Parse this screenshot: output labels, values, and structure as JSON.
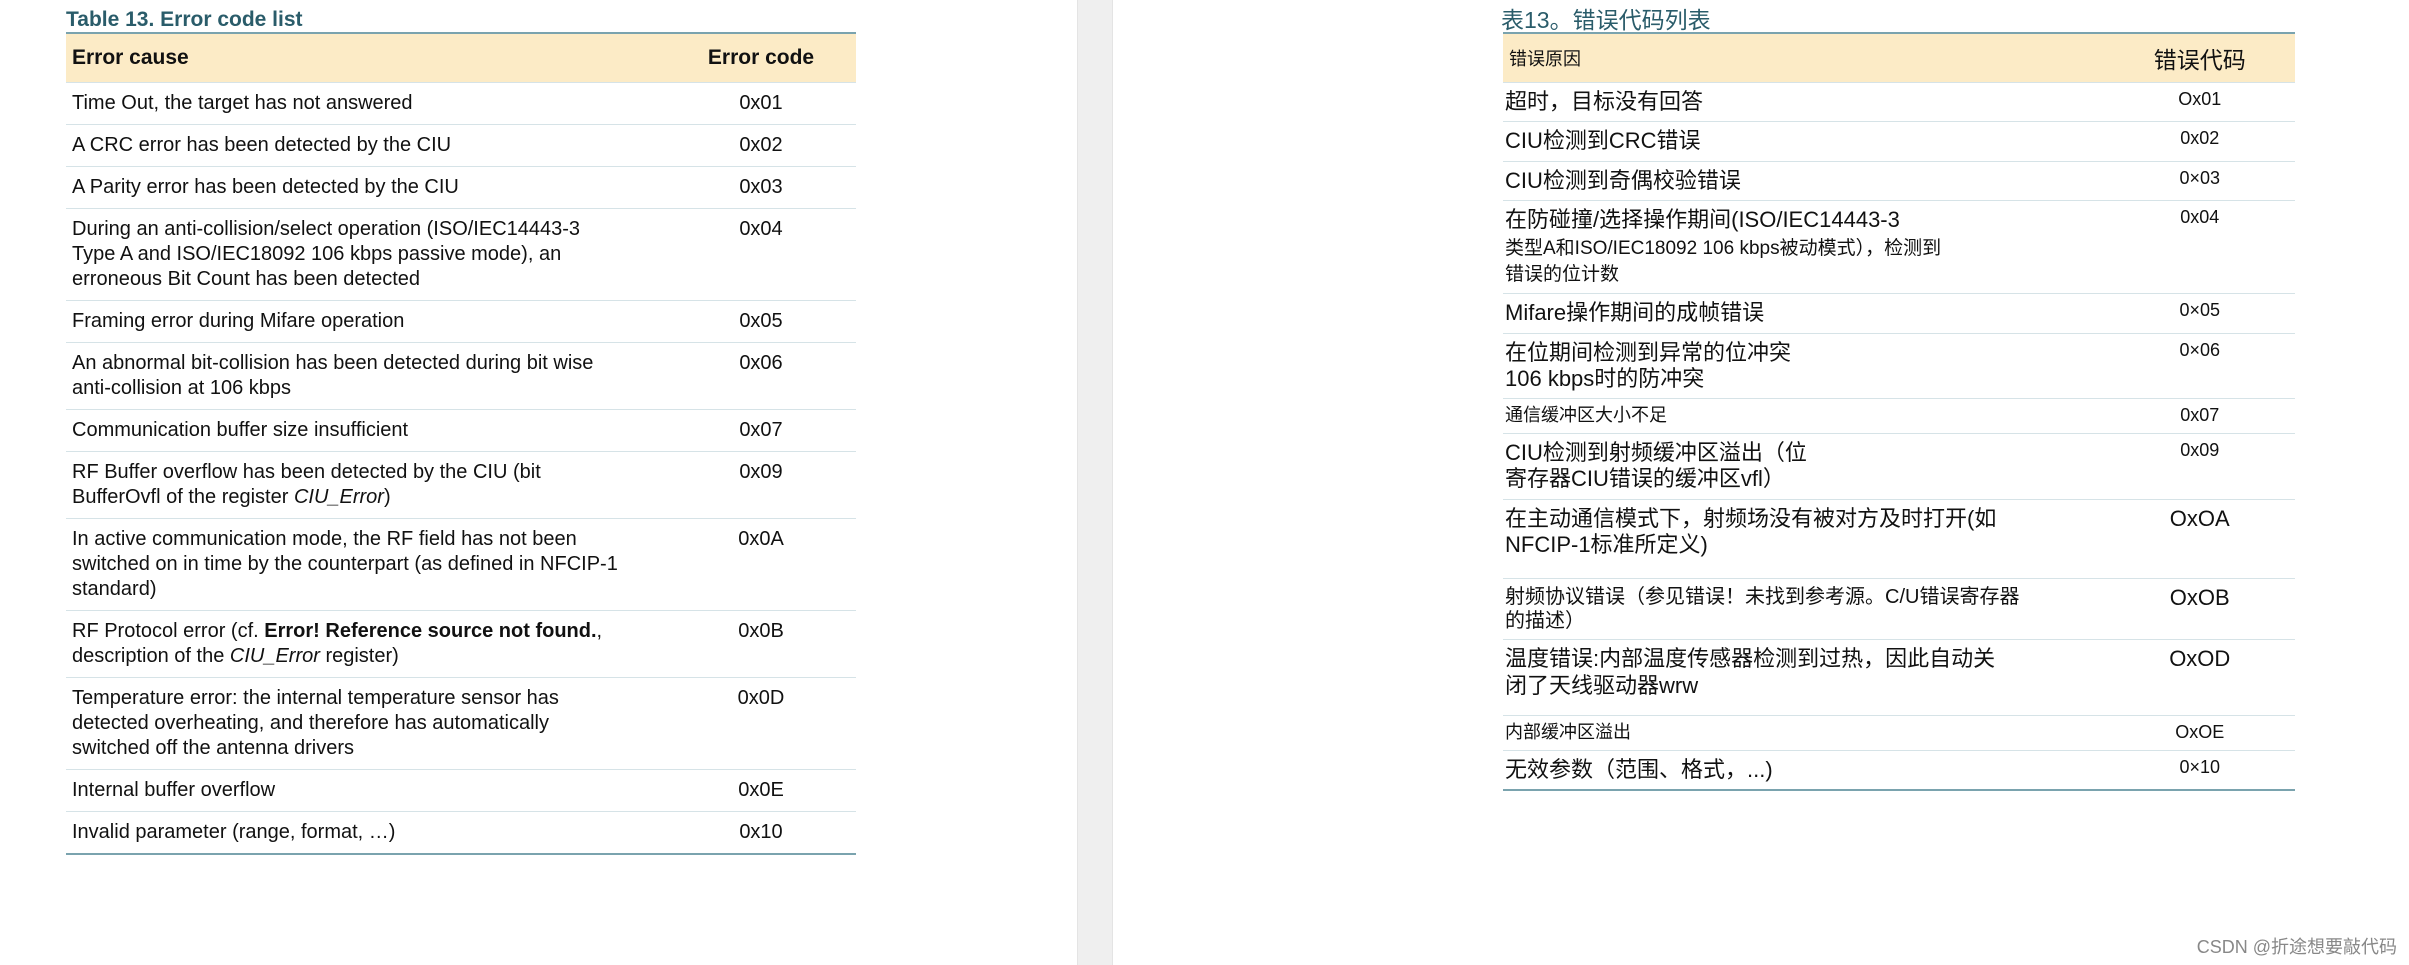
{
  "left": {
    "title": "Table 13.    Error code list",
    "header": {
      "cause": "Error cause",
      "code": "Error code"
    },
    "rows": [
      {
        "cause": "Time Out, the target has not answered",
        "code": "0x01"
      },
      {
        "cause": "A CRC error has been detected by the CIU",
        "code": "0x02"
      },
      {
        "cause": "A Parity error has been detected by the CIU",
        "code": "0x03"
      },
      {
        "cause_lines": [
          "During an anti-collision/select operation (ISO/IEC14443-3",
          "Type A and ISO/IEC18092 106 kbps passive mode), an",
          "erroneous Bit Count has been detected"
        ],
        "code": "0x04"
      },
      {
        "cause": "Framing error during Mifare operation",
        "code": "0x05"
      },
      {
        "cause_lines": [
          "An abnormal bit-collision has been detected during bit wise",
          "anti-collision at 106 kbps"
        ],
        "code": "0x06"
      },
      {
        "cause": "Communication buffer size insufficient",
        "code": "0x07"
      },
      {
        "cause_a": "RF Buffer overflow has been detected by the CIU (bit",
        "cause_b": "BufferOvfl of the register ",
        "cause_italic": "CIU_Error",
        "cause_c": ")",
        "code": "0x09"
      },
      {
        "cause_lines": [
          "In active communication mode, the RF field has not been",
          "switched on in time by the counterpart (as defined in NFCIP-1",
          "standard)"
        ],
        "code": "0x0A"
      },
      {
        "cause_a": "RF Protocol error (cf. ",
        "cause_bold": "Error! Reference source not found.",
        "cause_b": ",",
        "cause_c": "description of the ",
        "cause_italic": "CIU_Error",
        "cause_d": " register)",
        "code": "0x0B"
      },
      {
        "cause_lines": [
          "Temperature error: the internal temperature sensor has",
          "detected overheating, and therefore has automatically",
          "switched off the antenna drivers"
        ],
        "code": "0x0D"
      },
      {
        "cause": "Internal buffer overflow",
        "code": "0x0E"
      },
      {
        "cause": "Invalid parameter (range, format, …)",
        "code": "0x10"
      }
    ]
  },
  "right": {
    "title": "表13。错误代码列表",
    "header": {
      "cause": "错误原因",
      "code": "错误代码"
    },
    "rows": [
      {
        "cause": "超时，目标没有回答",
        "code": "Ox01"
      },
      {
        "cause": "CIU检测到CRC错误",
        "code": "0x02"
      },
      {
        "cause": "CIU检测到奇偶校验错误",
        "code": "0×03"
      },
      {
        "cause_lines": [
          "在防碰撞/选择操作期间(ISO/IEC14443-3",
          "类型A和ISO/IEC18092 106 kbps被动模式），检测到",
          "错误的位计数"
        ],
        "code": "0x04"
      },
      {
        "cause": "Mifare操作期间的成帧错误",
        "code": "0×05"
      },
      {
        "cause_lines": [
          "在位期间检测到异常的位冲突",
          "106 kbps时的防冲突"
        ],
        "code": "0×06"
      },
      {
        "cause": "通信缓冲区大小不足",
        "code": "0x07"
      },
      {
        "cause_lines": [
          "CIU检测到射频缓冲区溢出（位",
          "寄存器CIU错误的缓冲区vfl）"
        ],
        "code": "0x09"
      },
      {
        "cause_lines": [
          "在主动通信模式下，射频场没有被对方及时打开(如",
          "NFCIP-1标准所定义)"
        ],
        "code": "OxOA"
      },
      {
        "cause_lines": [
          "射频协议错误（参见错误！未找到参考源。C/U错误寄存器",
          "的描述）"
        ],
        "code": "OxOB"
      },
      {
        "cause_lines": [
          "温度错误:内部温度传感器检测到过热，因此自动关",
          "闭了天线驱动器wrw"
        ],
        "code": "OxOD"
      },
      {
        "cause": "内部缓冲区溢出",
        "code": "OxOE"
      },
      {
        "cause": "无效参数（范围、格式，...)",
        "code": "0×10"
      }
    ]
  },
  "watermark": "CSDN @折途想要敲代码"
}
